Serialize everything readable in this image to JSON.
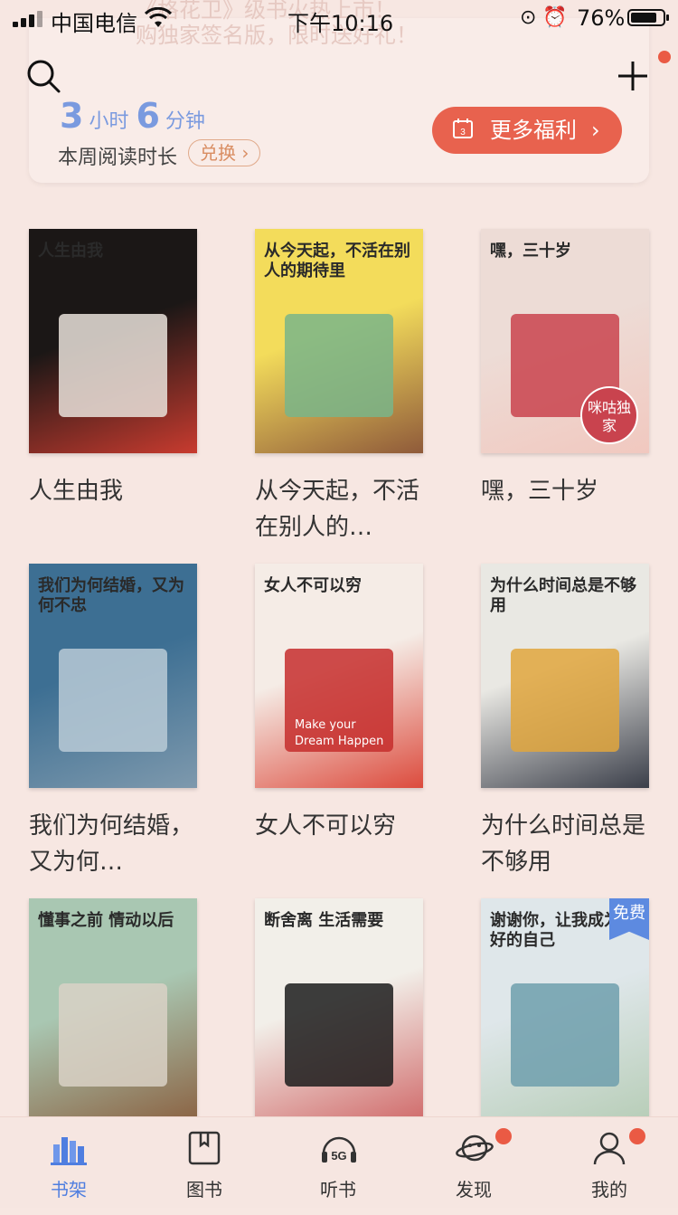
{
  "status": {
    "carrier": "中国电信",
    "time": "下午10:16",
    "battery": "76%",
    "battery_level": 0.76
  },
  "banner": {
    "line1": "《格花卫》级书火热上市！",
    "line2": "购独家签名版，限时送好礼！"
  },
  "reading": {
    "hours": "3",
    "hours_unit": "小时",
    "minutes": "6",
    "minutes_unit": "分钟",
    "label": "本周阅读时长",
    "exchange": "兑换",
    "welfare_button": "更多福利",
    "calendar_day": "3"
  },
  "books": [
    {
      "title": "人生由我",
      "cover_title": "人生由我",
      "colors": [
        "#1b1716",
        "#e9e2db",
        "#c83b2f"
      ]
    },
    {
      "title": "从今天起，不活在别人的…",
      "cover_title": "从今天起，不活在别人的期待里",
      "colors": [
        "#f3dc5b",
        "#79b58a",
        "#8f5a3a"
      ]
    },
    {
      "title": "嘿，三十岁",
      "cover_title": "嘿，三十岁",
      "badge": "咪咕独家",
      "colors": [
        "#eddcd6",
        "#c9434e",
        "#f1c8bf"
      ]
    },
    {
      "title": "我们为何结婚，又为何…",
      "cover_title": "我们为何结婚，又为何不忠",
      "colors": [
        "#3d6f93",
        "#b9cad6",
        "#7e99ad"
      ]
    },
    {
      "title": "女人不可以穷",
      "cover_title": "女人不可以穷",
      "wallet_text": "Make your Dream Happen",
      "colors": [
        "#f5ece6",
        "#c62e2d",
        "#dc4b3d"
      ]
    },
    {
      "title": "为什么时间总是不够用",
      "cover_title": "为什么时间总是不够用",
      "colors": [
        "#e9e8e3",
        "#e0a63d",
        "#3b3f4a"
      ]
    },
    {
      "title": "懂事之前情动以后",
      "cover_title": "懂事之前 情动以后",
      "colors": [
        "#a9c7b2",
        "#d9d1c6",
        "#8b6242"
      ]
    },
    {
      "title": "断舍离 生活需要",
      "cover_title": "断舍离 生活需要",
      "colors": [
        "#f2efe9",
        "#1c1c1c",
        "#d06a6a"
      ]
    },
    {
      "title": "谢谢你，让我成为更好的自己",
      "cover_title": "谢谢你，让我成为更好的自己",
      "badge": "免费",
      "colors": [
        "#dfe7ea",
        "#6e9fad",
        "#b7cdb7"
      ]
    }
  ],
  "tabs": [
    {
      "label": "书架",
      "icon": "bookshelf-icon",
      "active": true
    },
    {
      "label": "图书",
      "icon": "book-icon"
    },
    {
      "label": "听书",
      "icon": "5g-headphones-icon",
      "icon_text": "5G"
    },
    {
      "label": "发现",
      "icon": "planet-icon",
      "dot": true
    },
    {
      "label": "我的",
      "icon": "person-icon",
      "dot": true
    }
  ],
  "colors": {
    "accent": "#e8624e",
    "active_tab": "#4f7ee0",
    "background": "#f7e7e2"
  }
}
